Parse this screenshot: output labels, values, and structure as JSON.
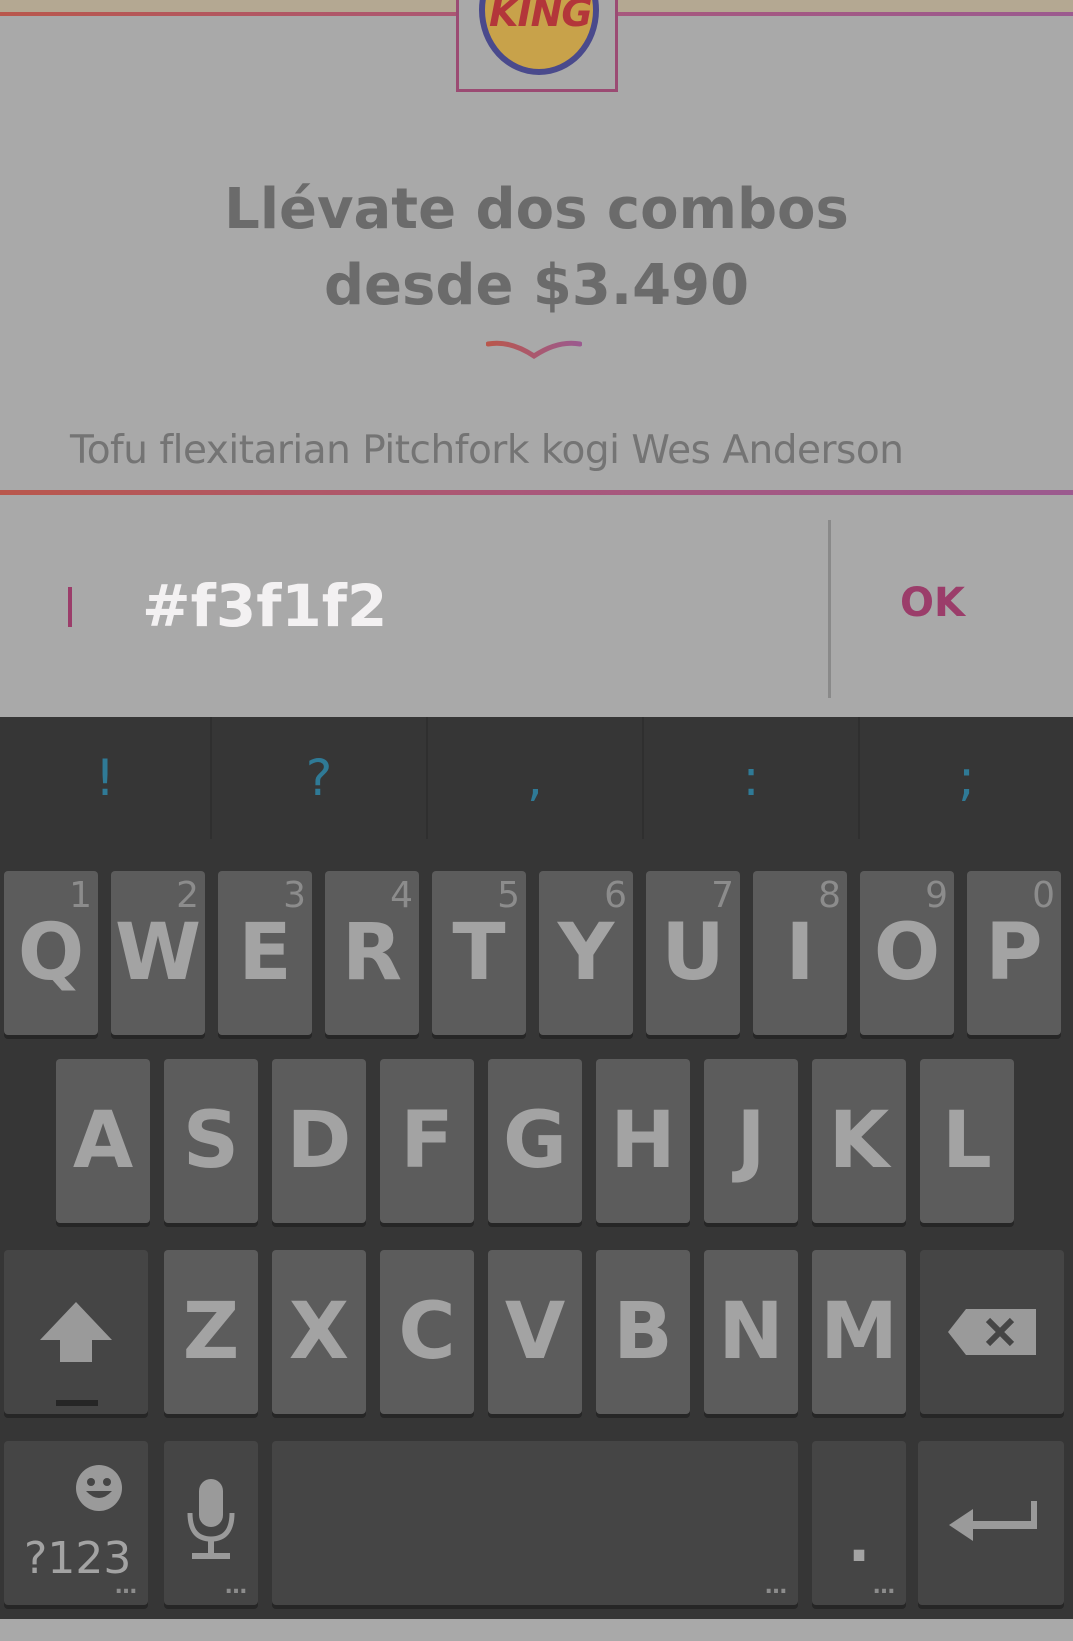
{
  "brand": {
    "logo_text": "KING"
  },
  "promo": {
    "headline_line1": "Llévate dos combos",
    "headline_line2": "desde $3.490",
    "description": "Tofu flexitarian Pitchfork kogi Wes Anderson"
  },
  "input": {
    "value": "#f3f1f2",
    "ok_label": "OK"
  },
  "keyboard": {
    "suggestions": [
      "!",
      "?",
      ",",
      ":",
      ";"
    ],
    "row1": [
      {
        "key": "Q",
        "hint": "1"
      },
      {
        "key": "W",
        "hint": "2"
      },
      {
        "key": "E",
        "hint": "3"
      },
      {
        "key": "R",
        "hint": "4"
      },
      {
        "key": "T",
        "hint": "5"
      },
      {
        "key": "Y",
        "hint": "6"
      },
      {
        "key": "U",
        "hint": "7"
      },
      {
        "key": "I",
        "hint": "8"
      },
      {
        "key": "O",
        "hint": "9"
      },
      {
        "key": "P",
        "hint": "0"
      }
    ],
    "row2": [
      "A",
      "S",
      "D",
      "F",
      "G",
      "H",
      "J",
      "K",
      "L"
    ],
    "row3": [
      "Z",
      "X",
      "C",
      "V",
      "B",
      "N",
      "M"
    ],
    "symbols_label": "?123",
    "period_label": ".",
    "colors": {
      "key_bg": "#5c5c5c",
      "board_bg": "#363636",
      "accent": "#9b3d6a",
      "suggestion": "#2f7a96"
    }
  }
}
